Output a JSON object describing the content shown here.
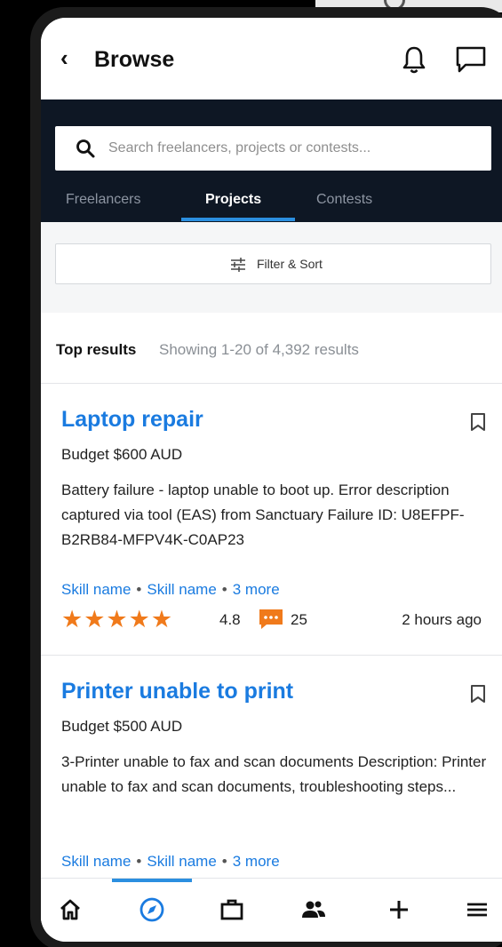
{
  "header": {
    "title": "Browse",
    "back_icon": "chevron-left-icon",
    "notifications_icon": "bell-icon",
    "messages_icon": "chat-icon"
  },
  "search": {
    "placeholder": "Search freelancers, projects or contests..."
  },
  "tabs": [
    {
      "label": "Freelancers",
      "active": false
    },
    {
      "label": "Projects",
      "active": true
    },
    {
      "label": "Contests",
      "active": false
    }
  ],
  "filter": {
    "label": "Filter & Sort",
    "icon": "sliders-icon"
  },
  "results": {
    "title": "Top results",
    "count_text": "Showing 1-20 of 4,392 results"
  },
  "projects": [
    {
      "title": "Laptop repair",
      "budget": "Budget $600 AUD",
      "description": "Battery failure - laptop unable to boot up. Error description captured via tool (EAS) from Sanctuary Failure ID: U8EFPF-B2RB84-MFPV4K-C0AP23",
      "skills": [
        "Skill name",
        "Skill name"
      ],
      "more": "3 more",
      "rating": 5,
      "rating_text": "4.8",
      "reviews": "25",
      "posted": "2 hours ago"
    },
    {
      "title": "Printer unable to print",
      "budget": "Budget $500 AUD",
      "description": "3-Printer unable to fax and scan documents Description: Printer unable to fax and scan documents, troubleshooting steps...",
      "skills": [
        "Skill name",
        "Skill name"
      ],
      "more": "3 more"
    }
  ],
  "bottom_nav": [
    {
      "icon": "home-icon",
      "active": false
    },
    {
      "icon": "compass-icon",
      "active": true
    },
    {
      "icon": "briefcase-icon",
      "active": false
    },
    {
      "icon": "people-icon",
      "active": false
    },
    {
      "icon": "plus-icon",
      "active": false
    },
    {
      "icon": "menu-icon",
      "active": false
    }
  ],
  "colors": {
    "accent": "#1a7be0",
    "navy": "#0e1724",
    "star": "#f07a1b"
  }
}
